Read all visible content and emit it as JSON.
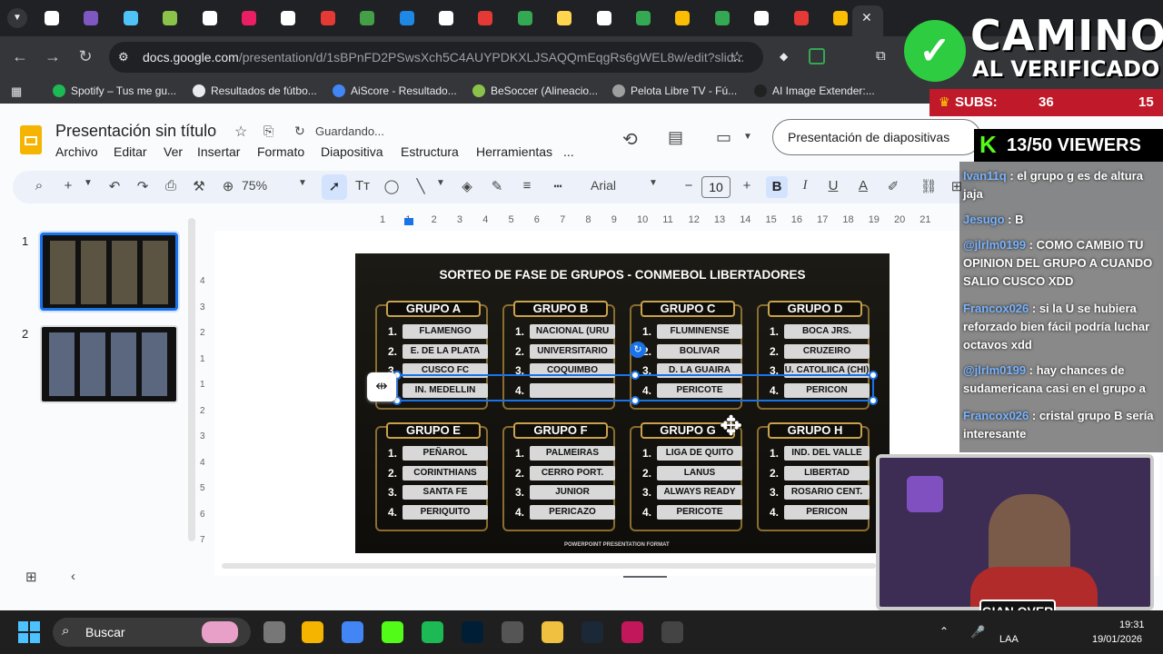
{
  "browser": {
    "url_main": "docs.google.com",
    "url_rest": "/presentation/d/1sBPnFD2PSwsXch5C4AUYPDKXLJSAQQmEqgRs6gWEL8w/edit?slid...",
    "tab_colors": [
      "#ffffff",
      "#7e57c2",
      "#4fc3f7",
      "#8bc34a",
      "#ffffff",
      "#e91e63",
      "#ffffff",
      "#e53935",
      "#43a047",
      "#1e88e5",
      "#ffffff",
      "#e53935",
      "#34a853",
      "#ffd54f",
      "#ffffff",
      "#34a853",
      "#fbbc04",
      "#34a853",
      "#ffffff",
      "#e53935",
      "#fbbc04"
    ],
    "bookmarks": [
      {
        "label": "Spotify – Tus me gu...",
        "color": "#1db954"
      },
      {
        "label": "Resultados de fútbo...",
        "color": "#e8eaed"
      },
      {
        "label": "AiScore - Resultado...",
        "color": "#4285f4"
      },
      {
        "label": "BeSoccer (Alineacio...",
        "color": "#8bc34a"
      },
      {
        "label": "Pelota Libre TV - Fú...",
        "color": "#9e9e9e"
      },
      {
        "label": "AI Image Extender:...",
        "color": "#212121"
      }
    ]
  },
  "docs": {
    "title": "Presentación sin título",
    "saving": "Guardando...",
    "menus": [
      "Archivo",
      "Editar",
      "Ver",
      "Insertar",
      "Formato",
      "Diapositiva",
      "Estructura",
      "Herramientas"
    ],
    "menu_more": "...",
    "slideshow_button": "Presentación de diapositivas",
    "zoom": "75%",
    "font": "Arial",
    "font_size": "10",
    "ruler_ticks": [
      "1",
      "1",
      "2",
      "3",
      "4",
      "5",
      "6",
      "7",
      "8",
      "9",
      "10",
      "11",
      "12",
      "13",
      "14",
      "15",
      "16",
      "17",
      "18",
      "19",
      "20",
      "21"
    ],
    "vruler_ticks": [
      "4",
      "3",
      "2",
      "1",
      "1",
      "2",
      "3",
      "4",
      "5",
      "6",
      "7"
    ],
    "thumbnails": [
      "1",
      "2"
    ]
  },
  "slide": {
    "title": "SORTEO DE FASE DE GRUPOS - CONMEBOL LIBERTADORES",
    "footer": "POWERPOINT PRESENTATION FORMAT",
    "groups": [
      {
        "name": "GRUPO A",
        "teams": [
          "FLAMENGO",
          "E. DE LA PLATA",
          "CUSCO FC",
          "IN. MEDELLIN"
        ]
      },
      {
        "name": "GRUPO B",
        "teams": [
          "NACIONAL (URU",
          "UNIVERSITARIO",
          "COQUIMBO",
          ""
        ]
      },
      {
        "name": "GRUPO C",
        "teams": [
          "FLUMINENSE",
          "BOLIVAR",
          "D. LA GUAIRA",
          "PERICOTE"
        ]
      },
      {
        "name": "GRUPO D",
        "teams": [
          "BOCA JRS.",
          "CRUZEIRO",
          "U. CATOLIICA (CHI)",
          "PERICON"
        ]
      },
      {
        "name": "GRUPO E",
        "teams": [
          "PEÑAROL",
          "CORINTHIANS",
          "SANTA FE",
          "PERIQUITO"
        ]
      },
      {
        "name": "GRUPO F",
        "teams": [
          "PALMEIRAS",
          "CERRO PORT.",
          "JUNIOR",
          "PERICAZO"
        ]
      },
      {
        "name": "GRUPO G",
        "teams": [
          "LIGA DE QUITO",
          "LANUS",
          "ALWAYS READY",
          "PERICOTE"
        ]
      },
      {
        "name": "GRUPO H",
        "teams": [
          "IND. DEL VALLE",
          "LIBERTAD",
          "ROSARIO CENT.",
          "PERICON"
        ]
      }
    ]
  },
  "stream": {
    "banner_line1": "CAMINO",
    "banner_line2": "AL VERIFICADO",
    "subs_label": "SUBS:",
    "subs_count": "36",
    "subs_goal": "15",
    "viewers": "13/50 VIEWERS",
    "chat": [
      {
        "user": "Ivan11q",
        "text": "el grupo g es de altura jaja"
      },
      {
        "user": "Jesugo",
        "text": "B"
      },
      {
        "user": "@jlrlm0199",
        "text": "COMO CAMBIO TU OPINION DEL GRUPO A CUANDO SALIO CUSCO XDD"
      },
      {
        "user": "Francox026",
        "text": "si la U se hubiera reforzado bien fácil podría luchar octavos xdd"
      },
      {
        "user": "@jlrlm0199",
        "text": "hay chances de sudamericana casi en el grupo a"
      },
      {
        "user": "Francox026",
        "text": "cristal grupo B sería interesante"
      }
    ],
    "cam_name": "GIAN OVER"
  },
  "taskbar": {
    "search": "Buscar",
    "time": "19:31",
    "date": "19/01/2026",
    "lang": "LAA"
  }
}
